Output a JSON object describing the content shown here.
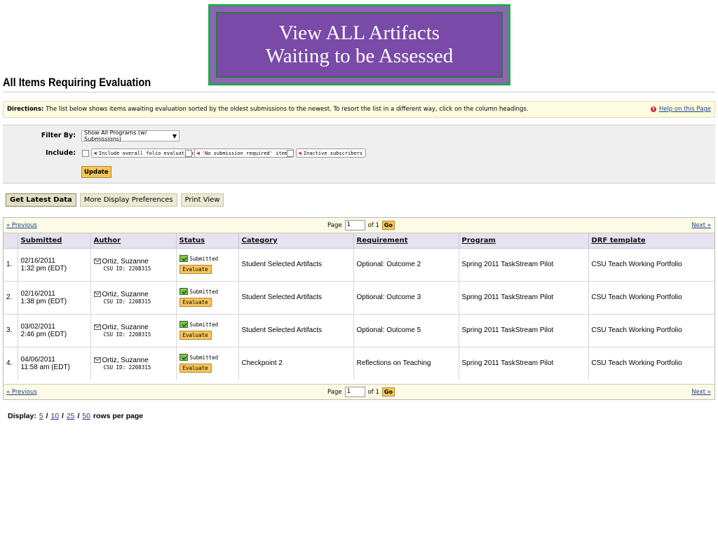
{
  "banner": {
    "line1": "View ALL Artifacts",
    "line2": "Waiting to be Assessed"
  },
  "page_title": "All Items Requiring Evaluation",
  "directions": {
    "label": "Directions:",
    "text": "The list below shows items awaiting evaluation sorted by the oldest submissions to the newest. To resort the list in a different way, click on the column headings.",
    "help_link": "Help on this Page"
  },
  "filter": {
    "filter_by_label": "Filter By:",
    "selected_program": "Show All Programs (w/ Submissions)",
    "include_label": "Include:",
    "options": [
      "Include overall folio evaluations",
      "'No submission required' items",
      "Inactive subscribers"
    ],
    "update_label": "Update"
  },
  "toolbar": {
    "get_latest": "Get Latest Data",
    "display_prefs": "More Display Preferences",
    "print_view": "Print View"
  },
  "pager": {
    "prev": "« Previous",
    "next": "Next »",
    "page_label": "Page",
    "page_value": "1",
    "of_label": "of 1",
    "go": "Go"
  },
  "table": {
    "columns": [
      "Submitted",
      "Author",
      "Status",
      "Category",
      "Requirement",
      "Program",
      "DRF template"
    ],
    "rows": [
      {
        "num": "1.",
        "date": "02/16/2011",
        "time": "1:32 pm (EDT)",
        "author": "Ortiz, Suzanne",
        "csu_id": "CSU ID: 2208315",
        "status": "Submitted",
        "action": "Evaluate",
        "category": "Student Selected Artifacts",
        "requirement": "Optional: Outcome 2",
        "program": "Spring 2011 TaskStream Pilot",
        "template": "CSU Teach Working Portfolio"
      },
      {
        "num": "2.",
        "date": "02/16/2011",
        "time": "1:38 pm (EDT)",
        "author": "Ortiz, Suzanne",
        "csu_id": "CSU ID: 2208315",
        "status": "Submitted",
        "action": "Evaluate",
        "category": "Student Selected Artifacts",
        "requirement": "Optional: Outcome 3",
        "program": "Spring 2011 TaskStream Pilot",
        "template": "CSU Teach Working Portfolio"
      },
      {
        "num": "3.",
        "date": "03/02/2011",
        "time": "2:46 pm (EDT)",
        "author": "Ortiz, Suzanne",
        "csu_id": "CSU ID: 2208315",
        "status": "Submitted",
        "action": "Evaluate",
        "category": "Student Selected Artifacts",
        "requirement": "Optional: Outcome 5",
        "program": "Spring 2011 TaskStream Pilot",
        "template": "CSU Teach Working Portfolio"
      },
      {
        "num": "4.",
        "date": "04/06/2011",
        "time": "11:58 am (EDT)",
        "author": "Ortiz, Suzanne",
        "csu_id": "CSU ID: 2208315",
        "status": "Submitted",
        "action": "Evaluate",
        "category": "Checkpoint 2",
        "requirement": "Reflections on Teaching",
        "program": "Spring 2011 TaskStream Pilot",
        "template": "CSU Teach Working Portfolio"
      }
    ]
  },
  "display": {
    "label": "Display:",
    "options": [
      "5",
      "10",
      "25",
      "50"
    ],
    "separator": "/",
    "suffix": "rows per page"
  },
  "colors": {
    "banner_purple": "#7a4aa8",
    "banner_border": "#22a84a",
    "header_row": "#e6e2f0",
    "button_orange": "#f7c55a"
  }
}
